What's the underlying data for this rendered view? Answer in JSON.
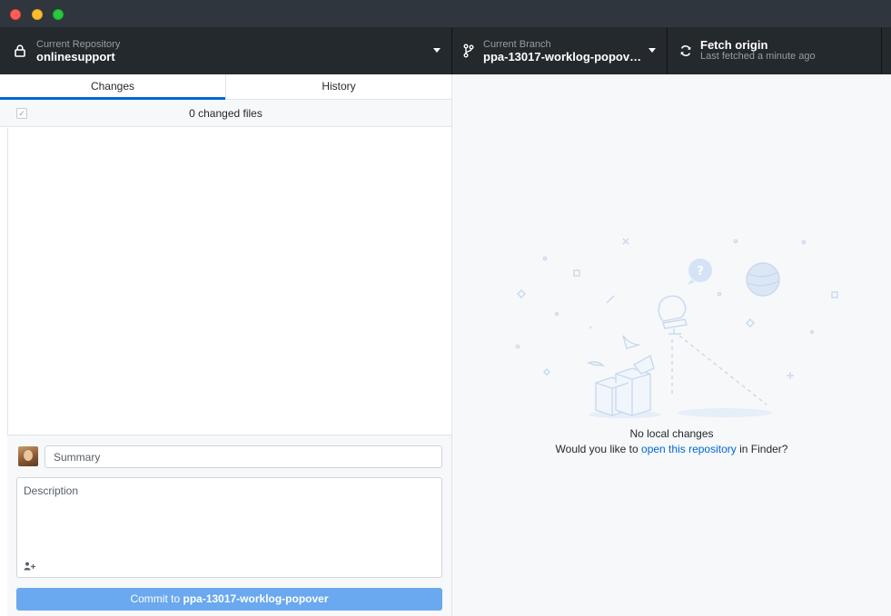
{
  "toolbar": {
    "repository": {
      "label": "Current Repository",
      "name": "onlinesupport",
      "icon": "lock-icon"
    },
    "branch": {
      "label": "Current Branch",
      "name": "ppa-13017-worklog-popov…",
      "icon": "git-branch-icon"
    },
    "fetch": {
      "title": "Fetch origin",
      "subtitle": "Last fetched a minute ago",
      "icon": "sync-icon"
    }
  },
  "tabs": [
    {
      "label": "Changes",
      "active": true
    },
    {
      "label": "History",
      "active": false
    }
  ],
  "changes": {
    "count_label": "0 changed files",
    "select_all_checked": true
  },
  "commit": {
    "summary_placeholder": "Summary",
    "description_placeholder": "Description",
    "button_prefix": "Commit to ",
    "button_branch": "ppa-13017-worklog-popover"
  },
  "blank_slate": {
    "title": "No local changes",
    "sub_before": "Would you like to ",
    "sub_link": "open this repository",
    "sub_after": " in Finder?"
  },
  "colors": {
    "toolbar_bg": "#24292e",
    "accent": "#0366d6",
    "commit_button": "#6aa8ef"
  }
}
